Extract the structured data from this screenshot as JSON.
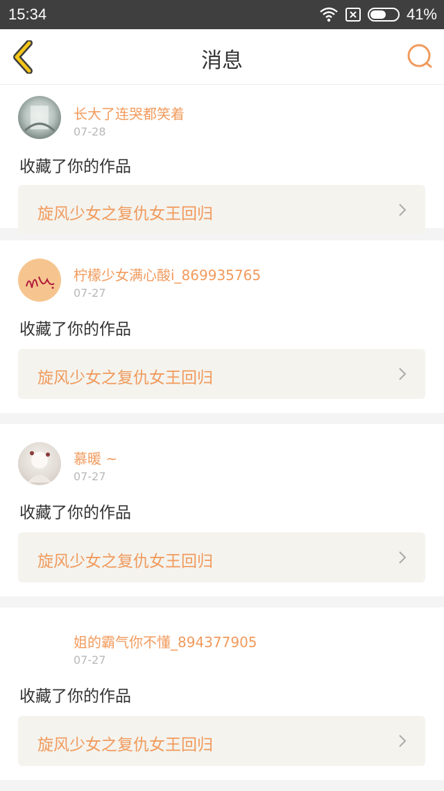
{
  "status_bar": {
    "time": "15:34",
    "battery": "41%"
  },
  "header": {
    "title": "消息"
  },
  "messages": [
    {
      "username": "长大了连哭都笑着",
      "date": "07-28",
      "action": "收藏了你的作品",
      "work_title": "旋风少女之复仇女王回归"
    },
    {
      "username": "柠檬少女满心酸i_869935765",
      "date": "07-27",
      "action": "收藏了你的作品",
      "work_title": "旋风少女之复仇女王回归"
    },
    {
      "username": "慕暖 ~",
      "date": "07-27",
      "action": "收藏了你的作品",
      "work_title": "旋风少女之复仇女王回归"
    },
    {
      "username": "姐的霸气你不懂_894377905",
      "date": "07-27",
      "action": "收藏了你的作品",
      "work_title": "旋风少女之复仇女王回归"
    }
  ],
  "colors": {
    "accent": "#f19a5c",
    "back_arrow": "#f5c518",
    "status_bar_bg": "#3f3f3f"
  },
  "icons": {
    "back": "chevron-left-icon",
    "search": "search-icon",
    "item_arrow": "chevron-right-icon"
  }
}
